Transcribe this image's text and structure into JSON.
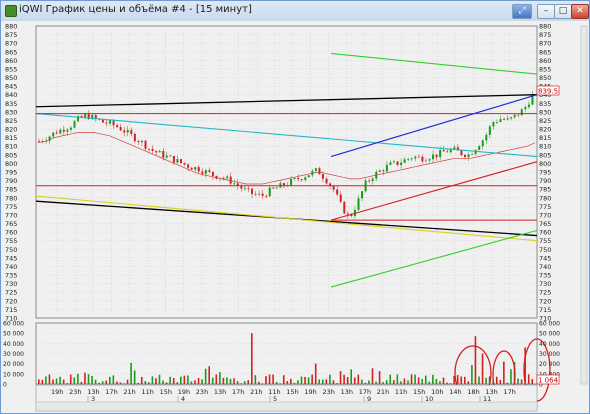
{
  "window": {
    "title": "iQWI График цены и объёма #4 - [15 минут]",
    "buttons": {
      "pin": "⤢",
      "minimize": "–",
      "maximize": "□",
      "close": "✕"
    }
  },
  "price_axis": {
    "labels": [
      "880",
      "875",
      "870",
      "865",
      "860",
      "855",
      "850",
      "845",
      "840",
      "835",
      "830",
      "825",
      "820",
      "815",
      "810",
      "805",
      "800",
      "795",
      "790",
      "785",
      "780",
      "775",
      "770",
      "765",
      "760",
      "755",
      "750",
      "745",
      "740",
      "735",
      "730",
      "725",
      "720",
      "715",
      "710"
    ],
    "min": 710,
    "max": 880,
    "current_price": "839.5"
  },
  "volume_axis": {
    "labels": [
      "60 000",
      "50 000",
      "40 000",
      "30 000",
      "20 000",
      "10 000",
      "0"
    ],
    "max": 60000,
    "current_volume": "1 064"
  },
  "time_axis": {
    "hour_labels": [
      "19h",
      "23h",
      "13h",
      "17h",
      "21h",
      "11h",
      "15h",
      "19h",
      "23h",
      "13h",
      "17h",
      "21h",
      "11h",
      "15h",
      "19h",
      "23h",
      "13h",
      "17h",
      "21h",
      "11h",
      "15h",
      "10h",
      "14h",
      "18h",
      "13h",
      "17h"
    ],
    "day_labels": [
      "3",
      "4",
      "5",
      "9",
      "10",
      "11"
    ]
  },
  "chart_data": {
    "type": "candlestick",
    "x": "sequential 15-minute bars",
    "price_close_approx": [
      813,
      815,
      818,
      820,
      822,
      826,
      828,
      826,
      824,
      823,
      821,
      818,
      815,
      812,
      808,
      806,
      804,
      802,
      800,
      798,
      797,
      795,
      793,
      792,
      790,
      787,
      784,
      782,
      781,
      784,
      786,
      788,
      790,
      792,
      794,
      796,
      791,
      785,
      775,
      768,
      777,
      788,
      793,
      796,
      799,
      800,
      802,
      804,
      803,
      804,
      805,
      807,
      808,
      806,
      805,
      810,
      815,
      824,
      826,
      825,
      828,
      832,
      839.5
    ],
    "moving_average_approx": [
      812,
      813,
      815,
      816,
      817,
      818,
      818,
      818,
      817,
      816,
      814,
      812,
      810,
      808,
      806,
      804,
      802,
      800,
      798,
      796,
      794,
      793,
      792,
      791,
      790,
      789,
      788,
      788,
      788,
      789,
      790,
      791,
      792,
      793,
      794,
      795,
      794,
      793,
      792,
      791,
      791,
      792,
      793,
      794,
      795,
      796,
      797,
      798,
      799,
      800,
      801,
      802,
      803,
      803,
      803,
      804,
      805,
      806,
      807,
      808,
      809,
      810,
      812
    ],
    "trendlines_count": 11,
    "volume_highlight_circles": 3,
    "ylim": [
      710,
      880
    ],
    "volume_ylim": [
      0,
      60000
    ],
    "grid": true
  }
}
